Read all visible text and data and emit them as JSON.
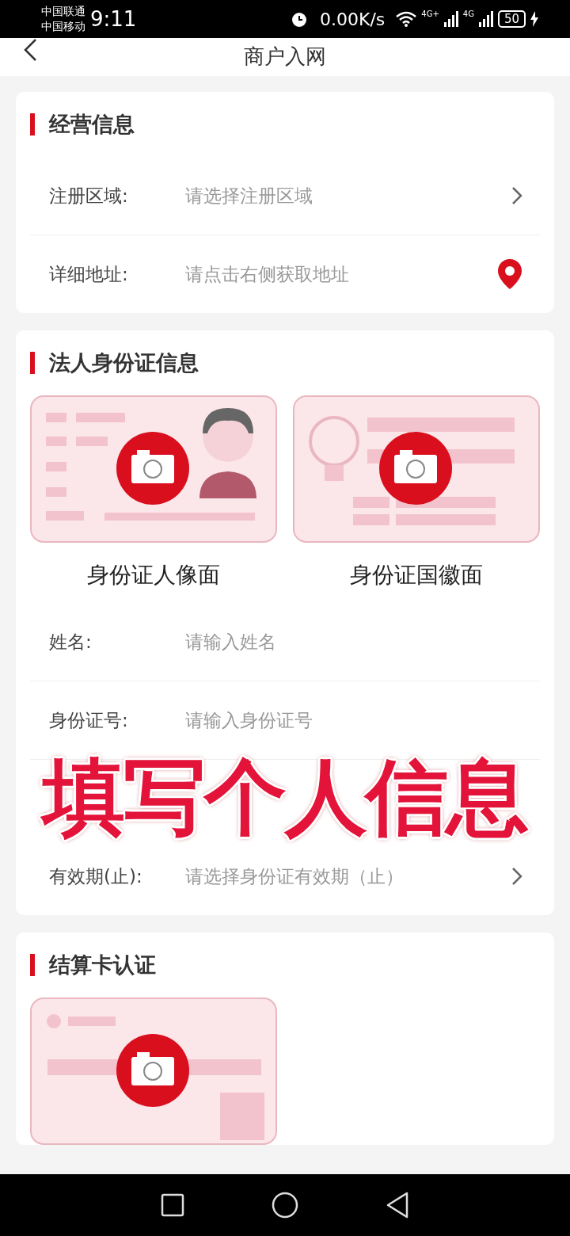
{
  "status_bar": {
    "carrier_1": "中国联通",
    "carrier_2": "中国移动",
    "time": "9:11",
    "net_speed": "0.00K/s",
    "network_1": "4G+",
    "network_2": "4G",
    "battery": "50"
  },
  "header": {
    "title": "商户入网"
  },
  "sections": [
    {
      "title": "经营信息",
      "rows": [
        {
          "kind": "select",
          "label": "注册区域:",
          "placeholder": "请选择注册区域"
        },
        {
          "kind": "location",
          "label": "详细地址:",
          "placeholder": "请点击右侧获取地址"
        }
      ]
    },
    {
      "title": "法人身份证信息",
      "uploads": [
        {
          "kind": "portrait",
          "caption": "身份证人像面"
        },
        {
          "kind": "emblem",
          "caption": "身份证国徽面"
        }
      ],
      "rows": [
        {
          "kind": "input",
          "label": "姓名:",
          "placeholder": "请输入姓名"
        },
        {
          "kind": "input",
          "label": "身份证号:",
          "placeholder": "请输入身份证号"
        },
        {
          "kind": "caption",
          "text": "填写个人信息"
        },
        {
          "kind": "select",
          "label": "有效期(止):",
          "placeholder": "请选择身份证有效期（止）"
        }
      ]
    },
    {
      "title": "结算卡认证",
      "uploads": [
        {
          "kind": "bankcard"
        }
      ]
    }
  ]
}
